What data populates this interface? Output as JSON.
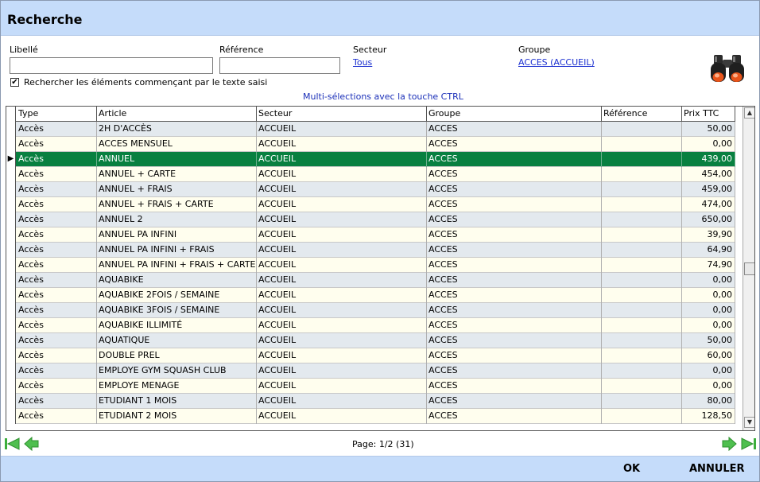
{
  "window": {
    "title": "Recherche"
  },
  "filters": {
    "libelle_label": "Libellé",
    "libelle_value": "",
    "reference_label": "Référence",
    "reference_value": "",
    "secteur_label": "Secteur",
    "secteur_value": "Tous",
    "groupe_label": "Groupe",
    "groupe_value": "ACCES (ACCUEIL) ",
    "starts_with_label": "Rechercher les éléments commençant par le texte saisi",
    "starts_with_checked": true
  },
  "hint": "Multi-sélections avec la touche CTRL",
  "grid": {
    "columns": [
      "Type",
      "Article",
      "Secteur",
      "Groupe",
      "Référence",
      "Prix TTC"
    ],
    "selected_index": 2,
    "rows": [
      [
        "Accès",
        "2H D'ACCÈS",
        "ACCUEIL",
        "ACCES",
        "",
        "50,00"
      ],
      [
        "Accès",
        "ACCES MENSUEL",
        "ACCUEIL",
        "ACCES",
        "",
        "0,00"
      ],
      [
        "Accès",
        "ANNUEL",
        "ACCUEIL",
        "ACCES",
        "",
        "439,00"
      ],
      [
        "Accès",
        "ANNUEL + CARTE",
        "ACCUEIL",
        "ACCES",
        "",
        "454,00"
      ],
      [
        "Accès",
        "ANNUEL + FRAIS",
        "ACCUEIL",
        "ACCES",
        "",
        "459,00"
      ],
      [
        "Accès",
        "ANNUEL + FRAIS + CARTE",
        "ACCUEIL",
        "ACCES",
        "",
        "474,00"
      ],
      [
        "Accès",
        "ANNUEL 2",
        "ACCUEIL",
        "ACCES",
        "",
        "650,00"
      ],
      [
        "Accès",
        "ANNUEL PA INFINI",
        "ACCUEIL",
        "ACCES",
        "",
        "39,90"
      ],
      [
        "Accès",
        "ANNUEL PA INFINI + FRAIS",
        "ACCUEIL",
        "ACCES",
        "",
        "64,90"
      ],
      [
        "Accès",
        "ANNUEL PA INFINI + FRAIS + CARTE",
        "ACCUEIL",
        "ACCES",
        "",
        "74,90"
      ],
      [
        "Accès",
        "AQUABIKE",
        "ACCUEIL",
        "ACCES",
        "",
        "0,00"
      ],
      [
        "Accès",
        "AQUABIKE 2FOIS / SEMAINE",
        "ACCUEIL",
        "ACCES",
        "",
        "0,00"
      ],
      [
        "Accès",
        "AQUABIKE 3FOIS / SEMAINE",
        "ACCUEIL",
        "ACCES",
        "",
        "0,00"
      ],
      [
        "Accès",
        "AQUABIKE ILLIMITÉ",
        "ACCUEIL",
        "ACCES",
        "",
        "0,00"
      ],
      [
        "Accès",
        "AQUATIQUE",
        "ACCUEIL",
        "ACCES",
        "",
        "50,00"
      ],
      [
        "Accès",
        "DOUBLE PREL",
        "ACCUEIL",
        "ACCES",
        "",
        "60,00"
      ],
      [
        "Accès",
        "EMPLOYE GYM SQUASH CLUB",
        "ACCUEIL",
        "ACCES",
        "",
        "0,00"
      ],
      [
        "Accès",
        "EMPLOYE MENAGE",
        "ACCUEIL",
        "ACCES",
        "",
        "0,00"
      ],
      [
        "Accès",
        "ETUDIANT 1 MOIS",
        "ACCUEIL",
        "ACCES",
        "",
        "80,00"
      ],
      [
        "Accès",
        "ETUDIANT 2 MOIS",
        "ACCUEIL",
        "ACCES",
        "",
        "128,50"
      ]
    ]
  },
  "pager": {
    "page_info": "Page: 1/2 (31)"
  },
  "footer": {
    "ok_label": "OK",
    "cancel_label": "ANNULER"
  },
  "colors": {
    "titlebar": "#c5dcfa",
    "selected_row": "#088040",
    "link": "#1a2fd0",
    "row_even": "#e3e9ee",
    "row_odd": "#fffeee"
  },
  "icons": {
    "search": "binoculars-icon",
    "first": "first-page-icon",
    "prev": "prev-page-icon",
    "next": "next-page-icon",
    "last": "last-page-icon"
  }
}
